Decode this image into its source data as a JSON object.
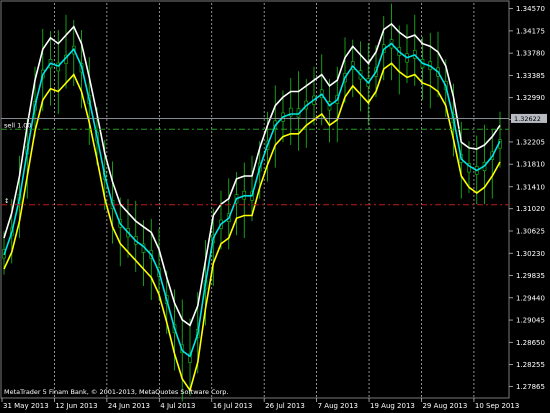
{
  "chart_data": {
    "type": "candlestick-with-bands",
    "x_labels": [
      "31 May 2013",
      "12 Jun 2013",
      "24 Jun 2013",
      "4 Jul 2013",
      "16 Jul 2013",
      "26 Jul 2013",
      "7 Aug 2013",
      "19 Aug 2013",
      "29 Aug 2013",
      "10 Sep 2013"
    ],
    "y_ticks": [
      "1.34570",
      "1.34175",
      "1.33780",
      "1.33385",
      "1.32990",
      "1.32600",
      "1.32205",
      "1.31810",
      "1.31410",
      "1.31020",
      "1.30625",
      "1.30230",
      "1.29835",
      "1.29440",
      "1.29045",
      "1.28650",
      "1.28255",
      "1.27865"
    ],
    "ylim": [
      1.2768,
      1.3467
    ],
    "current_price_label": "1.32622",
    "current_price": 1.32622,
    "sell_level_label": "sell 1.00",
    "sell_level": 1.3243,
    "buy_level": 1.3109,
    "copyright": "MetaTrader 5 Finam Bank, © 2001-2013, MetaQuotes Software Corp.",
    "series": [
      {
        "name": "upper",
        "color": "#ffffff",
        "values": [
          1.305,
          1.3095,
          1.316,
          1.325,
          1.333,
          1.3385,
          1.3405,
          1.3395,
          1.341,
          1.3425,
          1.3395,
          1.3335,
          1.327,
          1.32,
          1.315,
          1.311,
          1.3095,
          1.308,
          1.307,
          1.306,
          1.303,
          1.298,
          1.2935,
          1.2905,
          1.2895,
          1.293,
          1.301,
          1.309,
          1.311,
          1.312,
          1.3155,
          1.316,
          1.316,
          1.321,
          1.325,
          1.3285,
          1.33,
          1.331,
          1.331,
          1.332,
          1.333,
          1.334,
          1.332,
          1.333,
          1.337,
          1.339,
          1.3375,
          1.336,
          1.338,
          1.342,
          1.343,
          1.3415,
          1.3405,
          1.341,
          1.3395,
          1.339,
          1.338,
          1.3355,
          1.33,
          1.322,
          1.321,
          1.3208,
          1.3215,
          1.323,
          1.325
        ]
      },
      {
        "name": "middle",
        "color": "#00e5e5",
        "values": [
          1.302,
          1.306,
          1.312,
          1.3205,
          1.3285,
          1.334,
          1.336,
          1.3355,
          1.337,
          1.3385,
          1.3355,
          1.3295,
          1.323,
          1.316,
          1.311,
          1.3075,
          1.306,
          1.3045,
          1.3035,
          1.302,
          1.299,
          1.294,
          1.289,
          1.285,
          1.284,
          1.288,
          1.297,
          1.305,
          1.3075,
          1.3085,
          1.312,
          1.3125,
          1.3125,
          1.3175,
          1.3215,
          1.325,
          1.3265,
          1.327,
          1.327,
          1.3285,
          1.3295,
          1.3305,
          1.3285,
          1.3295,
          1.3335,
          1.3355,
          1.334,
          1.3325,
          1.3345,
          1.3385,
          1.3395,
          1.338,
          1.337,
          1.3375,
          1.336,
          1.3355,
          1.3345,
          1.332,
          1.3262,
          1.319,
          1.3178,
          1.317,
          1.3178,
          1.3195,
          1.3222
        ]
      },
      {
        "name": "lower",
        "color": "#ffff00",
        "values": [
          1.2995,
          1.3025,
          1.308,
          1.316,
          1.324,
          1.3295,
          1.3315,
          1.331,
          1.3325,
          1.334,
          1.331,
          1.3255,
          1.319,
          1.312,
          1.307,
          1.304,
          1.3025,
          1.301,
          1.2995,
          1.298,
          1.295,
          1.29,
          1.2845,
          1.28,
          1.278,
          1.283,
          1.2925,
          1.3005,
          1.304,
          1.305,
          1.3085,
          1.309,
          1.309,
          1.314,
          1.318,
          1.3215,
          1.323,
          1.3235,
          1.3235,
          1.325,
          1.326,
          1.327,
          1.325,
          1.326,
          1.33,
          1.332,
          1.3305,
          1.329,
          1.331,
          1.335,
          1.336,
          1.3345,
          1.3335,
          1.334,
          1.3325,
          1.332,
          1.331,
          1.3285,
          1.3225,
          1.316,
          1.314,
          1.313,
          1.314,
          1.316,
          1.3185
        ]
      }
    ]
  }
}
